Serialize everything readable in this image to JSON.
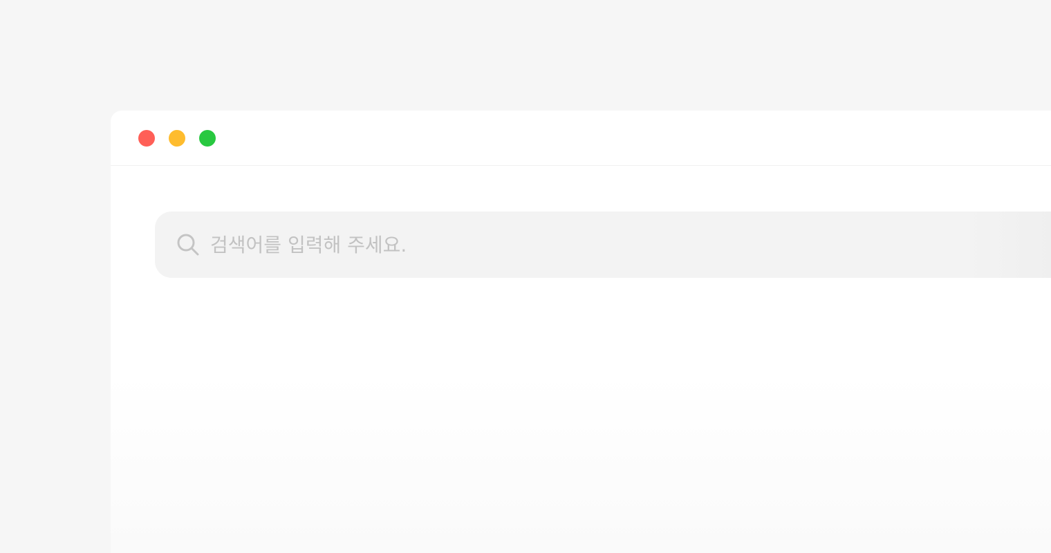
{
  "window": {
    "controls": {
      "close_color": "#ff5f57",
      "minimize_color": "#febc2e",
      "maximize_color": "#28c840"
    }
  },
  "search": {
    "value": "",
    "placeholder": "검색어를 입력해 주세요.",
    "icon": "search-icon"
  }
}
